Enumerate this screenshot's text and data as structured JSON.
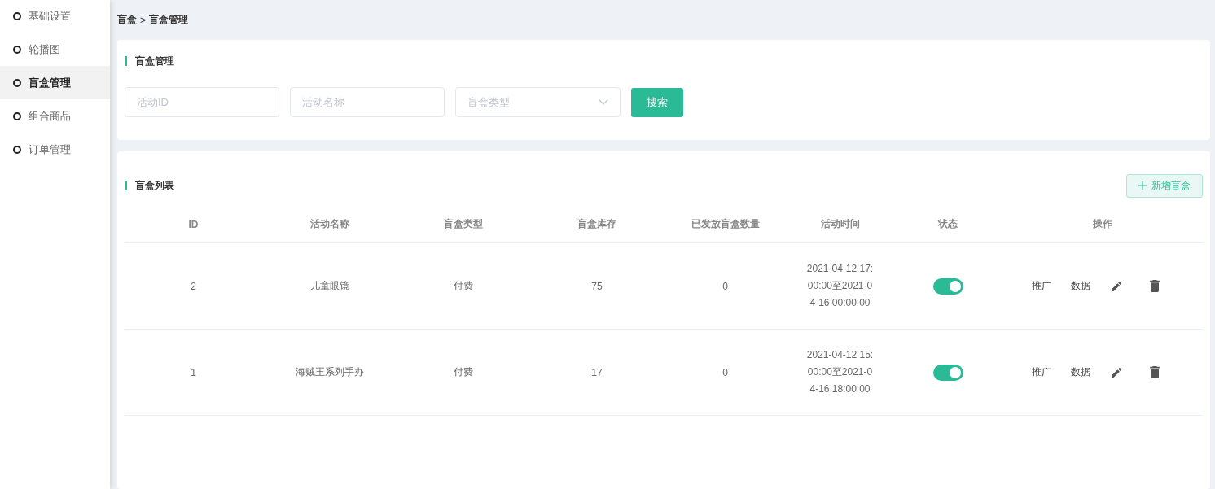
{
  "sidebar": {
    "items": [
      {
        "label": "基础设置",
        "selected": false
      },
      {
        "label": "轮播图",
        "selected": false
      },
      {
        "label": "盲盒管理",
        "selected": true
      },
      {
        "label": "组合商品",
        "selected": false
      },
      {
        "label": "订单管理",
        "selected": false
      }
    ]
  },
  "breadcrumb": {
    "parent": "盲盒",
    "separator": ">",
    "current": "盲盒管理"
  },
  "filter_panel": {
    "title": "盲盒管理",
    "fields": [
      {
        "kind": "input",
        "placeholder": "活动ID"
      },
      {
        "kind": "input",
        "placeholder": "活动名称"
      },
      {
        "kind": "select",
        "placeholder": "盲盒类型"
      }
    ],
    "search_button": "搜索"
  },
  "list_panel": {
    "title": "盲盒列表",
    "add_button": "新增盲盒",
    "table": {
      "columns": [
        "ID",
        "活动名称",
        "盲盒类型",
        "盲盒库存",
        "已发放盲盒数量",
        "活动时间",
        "状态",
        "操作"
      ],
      "rows": [
        {
          "id": "2",
          "name": "儿童眼镜",
          "type": "付费",
          "stock": "75",
          "issued": "0",
          "time": "2021-04-12 17:00:00至2021-04-16 00:00:00",
          "status_on": true,
          "actions": [
            "推广",
            "数据"
          ]
        },
        {
          "id": "1",
          "name": "海贼王系列手办",
          "type": "付费",
          "stock": "17",
          "issued": "0",
          "time": "2021-04-12 15:00:00至2021-04-16 18:00:00",
          "status_on": true,
          "actions": [
            "推广",
            "数据"
          ]
        }
      ]
    }
  }
}
